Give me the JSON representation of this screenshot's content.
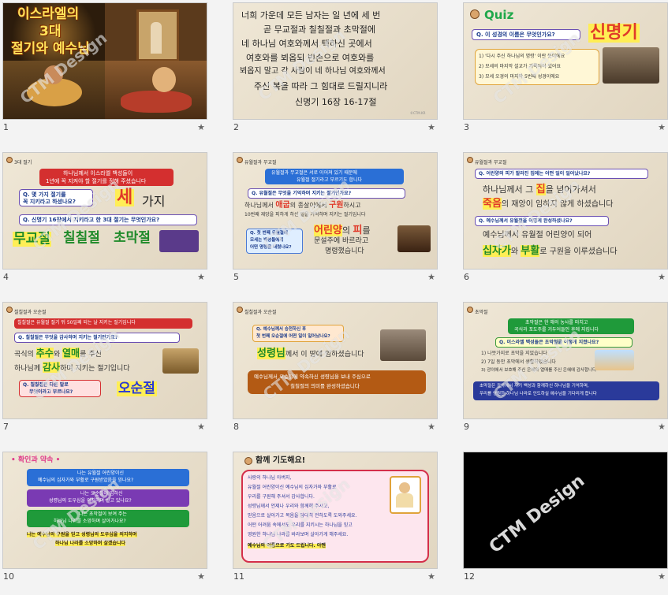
{
  "brand": "CTM Design",
  "slides": [
    {
      "num": "1",
      "title_lines": [
        "이스라엘의",
        "3대",
        "절기와 예수님"
      ]
    },
    {
      "num": "2",
      "lines": [
        "너희 가운데 모든 남자는 일 년에 세 번",
        "곧 무교절과 칠칠절과 초막절에",
        "네 하나님 여호와께서 택하신 곳에서",
        "여호와를 뵈옵되 빈손으로 여호와를",
        "뵈옵지 말고 각 사람이 네 하나님 여호와께서",
        "주신 복을 따라 그 힘대로 드릴지니라",
        "신명기 16장 16-17절"
      ],
      "copyright": "©CTM.KR"
    },
    {
      "num": "3",
      "quiz": "Quiz",
      "question": "Q. 이 성경의 이름은 무엇인가요?",
      "answer": "신명기",
      "items": [
        "1) '다시 주신 하나님의 명령' 이란 뜻이에요",
        "2) 모세의 마지막 설교가 기록되어 있어요",
        "3) 모세 오경의 마지막 5번째 성경이에요"
      ]
    },
    {
      "num": "4",
      "section": "3대 절기",
      "intro": [
        "하나님께서 이스라엘 백성들이",
        "1년에 꼭 지켜야 할 절기를 정해 주셨습니다"
      ],
      "q1": [
        "Q. 몇 가지 절기를",
        "꼭 지키라고 하셨나요?"
      ],
      "a1a": "세",
      "a1b": "가지",
      "q2": "Q. 신명기 16장에서 지키라고 한 3대 절기는 무엇인가요?",
      "feasts": [
        "무교절",
        "칠칠절",
        "초막절"
      ]
    },
    {
      "num": "5",
      "section": "유월절과 무교절",
      "top": [
        "유월절과 무교절은 서로 이어져 있기 때문에",
        "유월절 절기라고 부르기도 합니다"
      ],
      "q1": "Q. 유월절은 무엇을 기억하며 지키는 절기인가요?",
      "line1a": "하나님께서",
      "line1b": "애굽",
      "line1c": "의 종살이에서",
      "line1d": "구원",
      "line1e": "하시고",
      "line2": "10번째 재앙을 피하게 하신 일을 기억하며 지키는 절기입니다",
      "q2": [
        "Q. 첫 번째 유월절에",
        "모세는 백성들에게",
        "어떤 명령을 내렸나요?"
      ],
      "ans1a": "어린양",
      "ans1b": "의",
      "ans1c": "피",
      "ans1d": "를",
      "ans2": "문설주에 바르라고",
      "ans3": "명령했습니다"
    },
    {
      "num": "6",
      "section": "유월절과 무교절",
      "q1": "Q. 어린양의 피가 발라진 집에는 어떤 일이 일어났나요?",
      "l1a": "하나님께서 그",
      "l1b": "집",
      "l1c": "을 넘어가셔서",
      "l2a": "죽음",
      "l2b": "의 재앙이 임하지 않게 하셨습니다",
      "q2": "Q. 예수님께서 유월절을 어떻게 완성하셨나요?",
      "l3": "예수님께서 유월절 어린양이 되어",
      "l4a": "십자가",
      "l4b": "와",
      "l4c": "부활",
      "l4d": "로 구원을 이루셨습니다"
    },
    {
      "num": "7",
      "section": "칠칠절과 오순절",
      "top": "칠칠절은 유월절 절기 뒤 50일째 되는 날 지키는 절기입니다",
      "q1": "Q. 칠칠절은 무엇을 감사하며 지키는 절기인가요?",
      "l1a": "곡식의",
      "l1b": "추수",
      "l1c": "와",
      "l1d": "열매",
      "l1e": "를 주신",
      "l2a": "하나님께",
      "l2b": "감사",
      "l2c": "하며 지키는 절기입니다",
      "q2": [
        "Q. 칠칠절은 다른 말로",
        "무엇이라고 부르나요?"
      ],
      "ans": "오순절"
    },
    {
      "num": "8",
      "section": "칠칠절과 오순절",
      "q1": [
        "Q. 예수님께서 승천하신 후",
        "첫 번째 오순절에 어떤 일이 일어났나요?"
      ],
      "l1a": "성령님",
      "l1b": "께서 이 땅에 임하셨습니다",
      "box": [
        "예수님께서 오순절에 약속하신 성령님을 보내 주심으로",
        "칠칠절의 의미를 완성하셨습니다"
      ]
    },
    {
      "num": "9",
      "section": "초막절",
      "top": [
        "초막절은 한 해의 농사를 마치고",
        "곡식과 포도주를 거두어들인 후에 지킵니다"
      ],
      "q1": "Q. 이스라엘 백성들은 초막절을 어떻게 지켰나요?",
      "items": [
        "1) 나뭇가지로 초막을 지었습니다",
        "2) 7일 동안 초막에서 생활하였습니다",
        "3) 광야에서 보호해 주신 은혜와 열매를 주신 은혜에 감사합니다"
      ],
      "bottom": [
        "초막절은 광야에서 자기 백성과 함께하신 하나님을 기억하며,",
        "우리를 영원한 하나님 나라로 인도하실 예수님을 기다리게 합니다"
      ]
    },
    {
      "num": "10",
      "title": "확인과 약속",
      "boxes": [
        [
          "나는 유월절 어린양이신",
          "예수님의 십자가와 부활로 구원받았음을 믿나요?"
        ],
        [
          "나는 오순절에 임하신",
          "성령님의 도우심을 의지하며 살고 있나요?"
        ],
        [
          "나는 초막절이 보여 주는",
          "하나님 나라를 소망하며 살아가나요?"
        ]
      ],
      "bottom": [
        "나는 예수님의 구원을 믿고 성령님의 도우심을 의지하며",
        "하나님 나라를 소망하며 살겠습니다"
      ]
    },
    {
      "num": "11",
      "title": "함께 기도해요!",
      "lines": [
        "사랑의 하나님 아버지,",
        "유월절 어린양이신 예수님의 십자가와 부활로",
        "우리를 구원해 주셔서 감사합니다.",
        "성령님께서 언제나 우리와 함께해 주시고,",
        "믿음으로 살아가고 복음을 담대히 전하도록 도와주세요.",
        "어떤 어려움 속에서도 우리를 지키시는 하나님을 믿고",
        "영원한 하나님 나라를 바라보며 살아가게 해주세요.",
        "예수님의 이름으로 기도 드립니다. 아멘"
      ]
    },
    {
      "num": "12"
    }
  ],
  "star": "★"
}
